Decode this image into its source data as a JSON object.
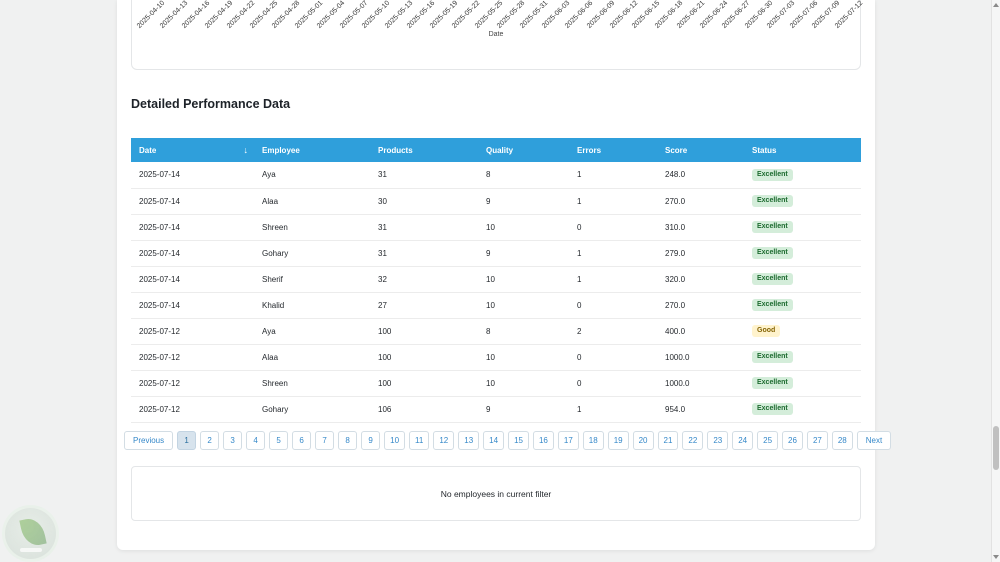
{
  "colors": {
    "table_header_bg": "#2f9fdb",
    "table_header_text": "#ffffff",
    "badge_excellent_bg": "#d4edda",
    "badge_excellent_text": "#1c6b2f",
    "badge_good_bg": "#fff3cd",
    "badge_good_text": "#856404",
    "pagination_text": "#3588c9",
    "pagination_active_bg": "#d7e3ed",
    "pagination_active_text": "#2a6f9f",
    "pagination_active_border": "#c3d4e2"
  },
  "chart": {
    "xlabel": "Date",
    "tick_labels": [
      "2025-04-10",
      "2025-04-13",
      "2025-04-16",
      "2025-04-19",
      "2025-04-22",
      "2025-04-25",
      "2025-04-28",
      "2025-05-01",
      "2025-05-04",
      "2025-05-07",
      "2025-05-10",
      "2025-05-13",
      "2025-05-16",
      "2025-05-19",
      "2025-05-22",
      "2025-05-25",
      "2025-05-28",
      "2025-05-31",
      "2025-06-03",
      "2025-06-06",
      "2025-06-09",
      "2025-06-12",
      "2025-06-15",
      "2025-06-18",
      "2025-06-21",
      "2025-06-24",
      "2025-06-27",
      "2025-06-30",
      "2025-07-03",
      "2025-07-06",
      "2025-07-09",
      "2025-07-12"
    ]
  },
  "section_title": "Detailed Performance Data",
  "table": {
    "columns": [
      "Date",
      "Employee",
      "Products",
      "Quality",
      "Errors",
      "Score",
      "Status"
    ],
    "sort_icon": "↓",
    "rows": [
      {
        "date": "2025-07-14",
        "employee": "Aya",
        "products": "31",
        "quality": "8",
        "errors": "1",
        "score": "248.0",
        "status": "Excellent"
      },
      {
        "date": "2025-07-14",
        "employee": "Alaa",
        "products": "30",
        "quality": "9",
        "errors": "1",
        "score": "270.0",
        "status": "Excellent"
      },
      {
        "date": "2025-07-14",
        "employee": "Shreen",
        "products": "31",
        "quality": "10",
        "errors": "0",
        "score": "310.0",
        "status": "Excellent"
      },
      {
        "date": "2025-07-14",
        "employee": "Gohary",
        "products": "31",
        "quality": "9",
        "errors": "1",
        "score": "279.0",
        "status": "Excellent"
      },
      {
        "date": "2025-07-14",
        "employee": "Sherif",
        "products": "32",
        "quality": "10",
        "errors": "1",
        "score": "320.0",
        "status": "Excellent"
      },
      {
        "date": "2025-07-14",
        "employee": "Khalid",
        "products": "27",
        "quality": "10",
        "errors": "0",
        "score": "270.0",
        "status": "Excellent"
      },
      {
        "date": "2025-07-12",
        "employee": "Aya",
        "products": "100",
        "quality": "8",
        "errors": "2",
        "score": "400.0",
        "status": "Good"
      },
      {
        "date": "2025-07-12",
        "employee": "Alaa",
        "products": "100",
        "quality": "10",
        "errors": "0",
        "score": "1000.0",
        "status": "Excellent"
      },
      {
        "date": "2025-07-12",
        "employee": "Shreen",
        "products": "100",
        "quality": "10",
        "errors": "0",
        "score": "1000.0",
        "status": "Excellent"
      },
      {
        "date": "2025-07-12",
        "employee": "Gohary",
        "products": "106",
        "quality": "9",
        "errors": "1",
        "score": "954.0",
        "status": "Excellent"
      }
    ]
  },
  "pagination": {
    "previous_label": "Previous",
    "next_label": "Next",
    "pages": [
      "1",
      "2",
      "3",
      "4",
      "5",
      "6",
      "7",
      "8",
      "9",
      "10",
      "11",
      "12",
      "13",
      "14",
      "15",
      "16",
      "17",
      "18",
      "19",
      "20",
      "21",
      "22",
      "23",
      "24",
      "25",
      "26",
      "27",
      "28"
    ],
    "active_page": "1"
  },
  "empty_state": {
    "message": "No employees in current filter"
  }
}
